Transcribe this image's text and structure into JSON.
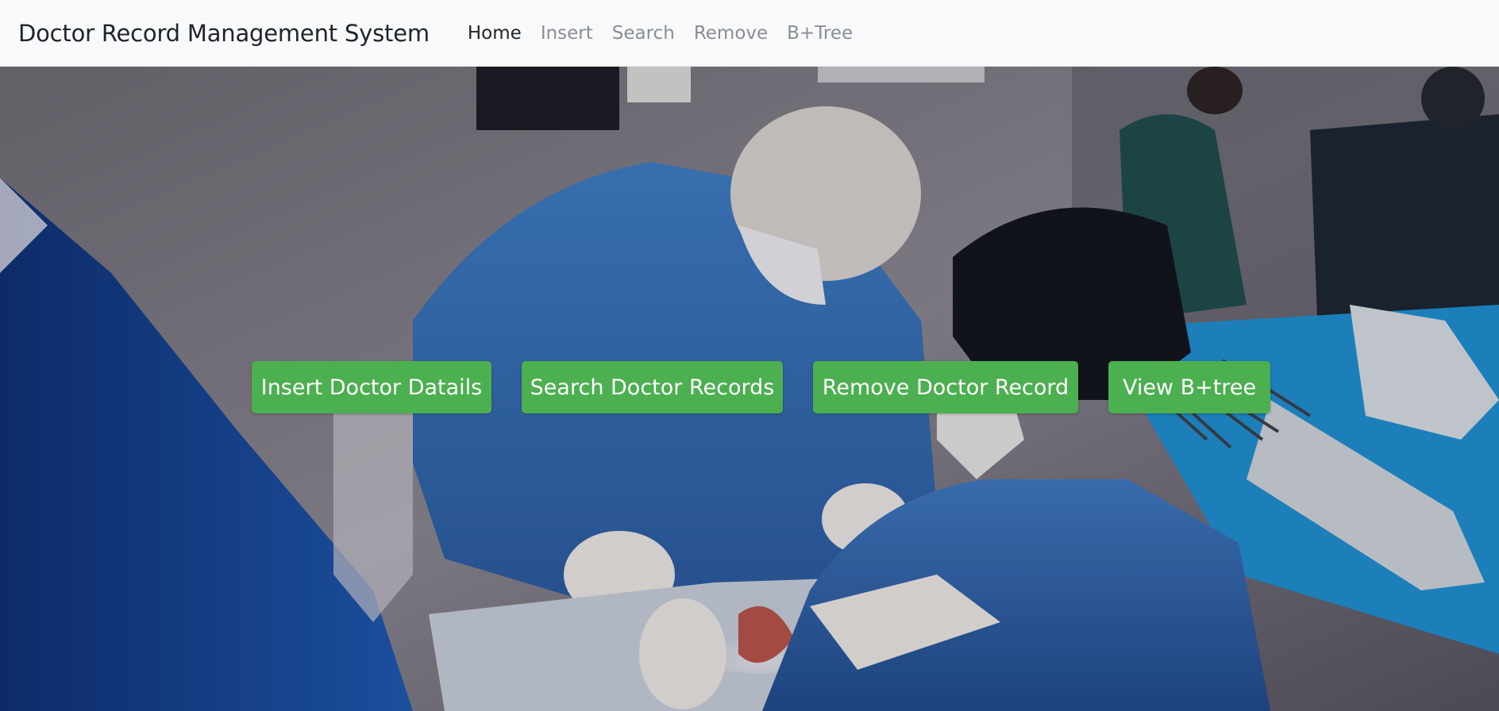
{
  "navbar": {
    "brand": "Doctor Record Management System",
    "links": [
      {
        "label": "Home",
        "active": true
      },
      {
        "label": "Insert",
        "active": false
      },
      {
        "label": "Search",
        "active": false
      },
      {
        "label": "Remove",
        "active": false
      },
      {
        "label": "B+Tree",
        "active": false
      }
    ]
  },
  "hero": {
    "background": "operating-room-photo",
    "buttons": [
      {
        "label": "Insert Doctor Datails"
      },
      {
        "label": "Search Doctor Records"
      },
      {
        "label": "Remove Doctor Record"
      },
      {
        "label": "View B+tree"
      }
    ]
  },
  "colors": {
    "button_bg": "#4caf50",
    "button_text": "#ffffff",
    "navbar_bg": "#f8f9fa",
    "nav_active": "#212529",
    "nav_inactive": "#8a8d91"
  }
}
